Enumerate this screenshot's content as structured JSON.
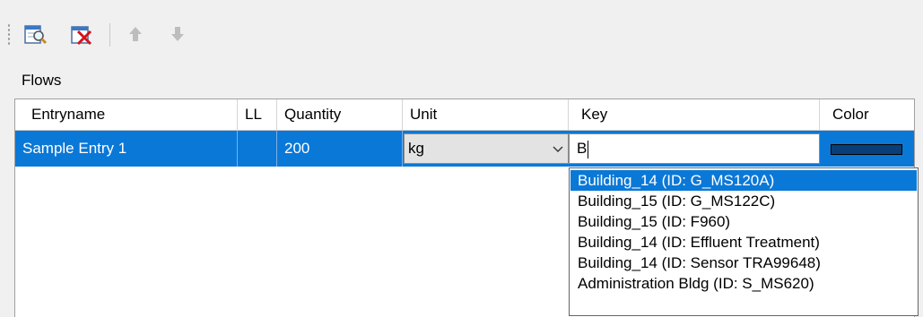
{
  "toolbar": {
    "buttons": [
      {
        "name": "open-entry-icon"
      },
      {
        "name": "delete-entry-icon"
      },
      {
        "name": "move-up-icon"
      },
      {
        "name": "move-down-icon"
      }
    ]
  },
  "group": {
    "label": "Flows"
  },
  "grid": {
    "columns": [
      "Entryname",
      "LL",
      "Quantity",
      "Unit",
      "Key",
      "Color"
    ],
    "rows": [
      {
        "entryname": "Sample Entry 1",
        "ll": "",
        "quantity": "200",
        "unit": "kg",
        "key": "B",
        "color": "#0a3e78"
      }
    ]
  },
  "dropdown": {
    "items": [
      "Building_14 (ID: G_MS120A)",
      "Building_15 (ID: G_MS122C)",
      "Building_15 (ID: F960)",
      "Building_14 (ID: Effluent Treatment)",
      "Building_14 (ID: Sensor TRA99648)",
      "Administration Bldg (ID: S_MS620)"
    ],
    "selected_index": 0
  },
  "colors": {
    "selection": "#0a78d7",
    "background": "#f0f0f0"
  }
}
